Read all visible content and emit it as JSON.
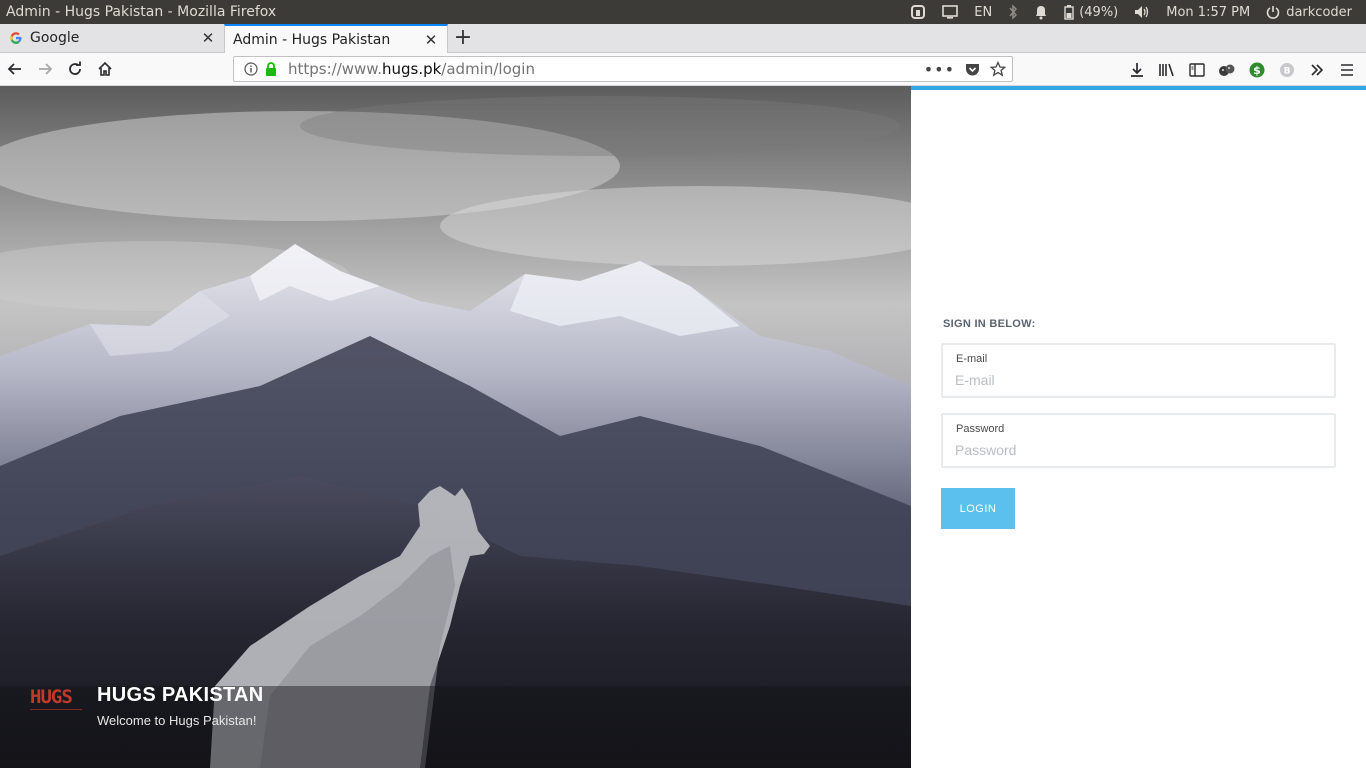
{
  "os_panel": {
    "window_title": "Admin - Hugs Pakistan - Mozilla Firefox",
    "keyboard_layout": "EN",
    "battery": "(49%)",
    "clock": "Mon  1:57 PM",
    "user": "darkcoder"
  },
  "browser": {
    "tabs": [
      {
        "label": "Google",
        "active": false,
        "favicon": "google-g-icon"
      },
      {
        "label": "Admin - Hugs Pakistan",
        "active": true,
        "favicon": "none"
      }
    ],
    "url": {
      "prefix": "https://www.",
      "host": "hugs.pk",
      "path": "/admin/login"
    },
    "accent_color": "#0a84ff"
  },
  "hero": {
    "logo_text": "HUGS",
    "title": "HUGS PAKISTAN",
    "subtitle": "Welcome to Hugs Pakistan!"
  },
  "login": {
    "heading": "SIGN IN BELOW:",
    "email": {
      "label": "E-mail",
      "placeholder": "E-mail",
      "value": ""
    },
    "password": {
      "label": "Password",
      "placeholder": "Password",
      "value": ""
    },
    "submit_label": "LOGIN",
    "accent_color": "#5bc0ed",
    "top_bar_color": "#32a8e6"
  }
}
